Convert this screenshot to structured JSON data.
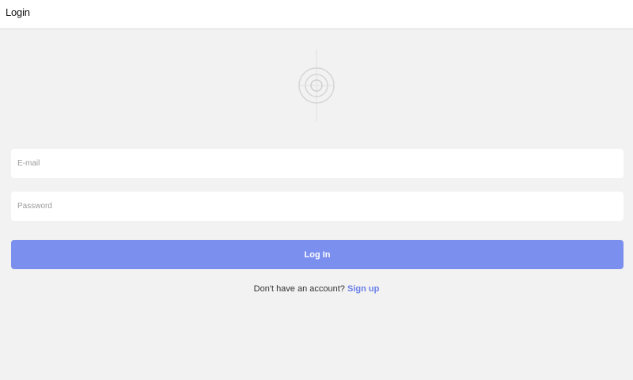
{
  "header": {
    "title": "Login"
  },
  "logo": {
    "icon": "concentric-circles-logo-icon"
  },
  "form": {
    "email_placeholder": "E-mail",
    "password_placeholder": "Password",
    "submit_label": "Log In"
  },
  "signup": {
    "prompt": "Don't have an account?",
    "link_label": "Sign up"
  },
  "colors": {
    "primary_button": "#7b8fef",
    "link": "#6a7fe8",
    "background": "#f2f2f2"
  }
}
